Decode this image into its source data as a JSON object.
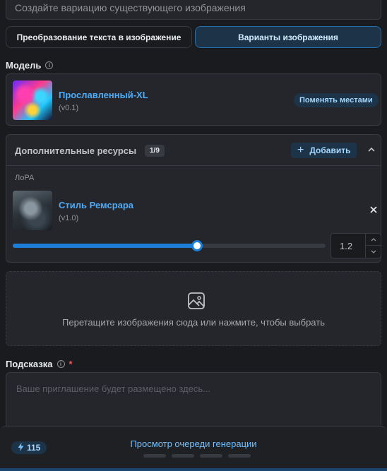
{
  "description": {
    "value": "Создайте вариацию существующего изображения"
  },
  "mode_tabs": [
    {
      "label": "Преобразование текста в изображение",
      "active": false
    },
    {
      "label": "Варианты изображения",
      "active": true
    }
  ],
  "model": {
    "label": "Модель",
    "name": "Прославленный-XL",
    "version": "(v0.1)",
    "swap_label": "Поменять местами"
  },
  "resources": {
    "title": "Дополнительные ресурсы",
    "count_badge": "1/9",
    "add_label": "Добавить",
    "section_label": "ЛоРА",
    "lora": {
      "name": "Стиль Ремсрара",
      "version": "(v1.0)",
      "strength": "1.2",
      "slider_fraction": 0.59
    }
  },
  "dropzone": {
    "text": "Перетащите изображения сюда или нажмите, чтобы выбрать"
  },
  "prompt": {
    "label": "Подсказка",
    "required_mark": "*",
    "placeholder": "Ваше приглашение будет размещено здесь..."
  },
  "queue": {
    "energy": "115",
    "link_label": "Просмотр очереди генерации"
  },
  "colors": {
    "accent": "#1c7ed6",
    "link": "#4dabf7",
    "required": "#fa5252"
  },
  "icons": [
    "info-icon",
    "plus-icon",
    "chevron-up-icon",
    "close-icon",
    "chevron-up-small-icon",
    "chevron-down-small-icon",
    "image-icon",
    "lightning-icon"
  ]
}
